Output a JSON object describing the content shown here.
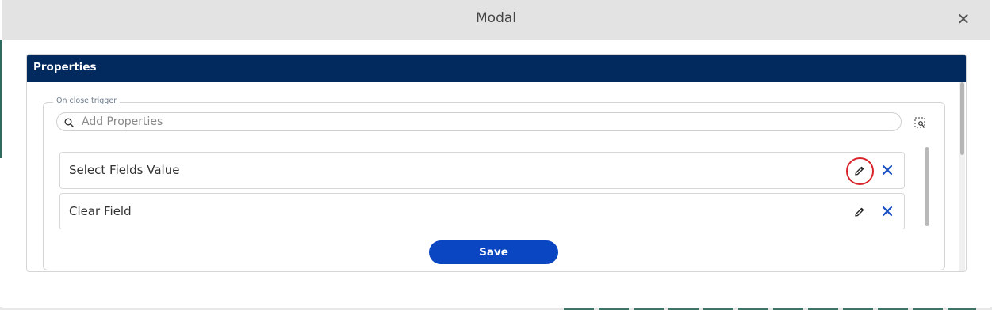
{
  "modal": {
    "title": "Modal",
    "close_icon": "close-icon"
  },
  "panel": {
    "title": "Properties",
    "header_color": "#022a5e"
  },
  "trigger": {
    "legend": "On close trigger",
    "search": {
      "placeholder": "Add Properties",
      "value": ""
    },
    "items": [
      {
        "label": "Select Fields Value",
        "edit_icon": "pencil-icon",
        "delete_icon": "close-icon",
        "highlighted": true
      },
      {
        "label": "Clear Field",
        "edit_icon": "pencil-icon",
        "delete_icon": "close-icon",
        "highlighted": false
      }
    ]
  },
  "actions": {
    "save_label": "Save",
    "save_color": "#0b46c2"
  },
  "colors": {
    "highlight_ring": "#d9242b",
    "delete_icon": "#1a4fc4"
  }
}
